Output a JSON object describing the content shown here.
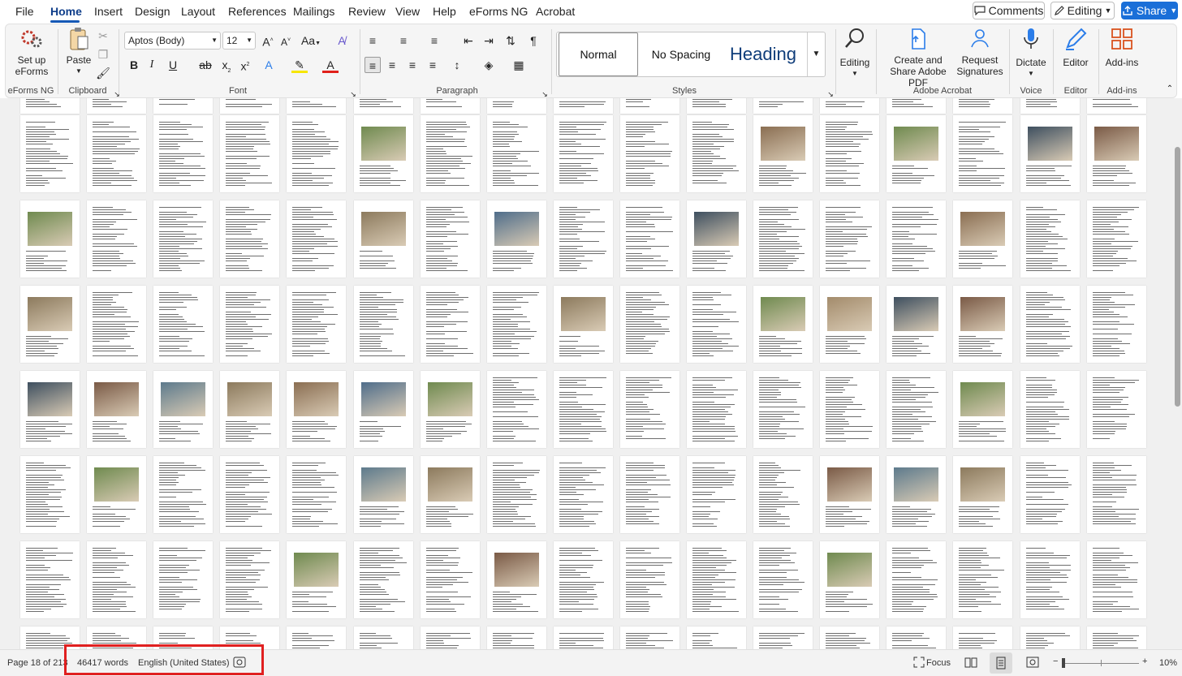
{
  "menu": {
    "tabs": [
      "File",
      "Home",
      "Insert",
      "Design",
      "Layout",
      "References",
      "Mailings",
      "Review",
      "View",
      "Help",
      "eForms NG",
      "Acrobat"
    ],
    "active_tab": "Home",
    "comments_label": "Comments",
    "editing_label": "Editing",
    "share_label": "Share"
  },
  "ribbon": {
    "eforms": {
      "button_label": "Set up eForms",
      "group_label": "eForms NG"
    },
    "clipboard": {
      "paste_label": "Paste",
      "group_label": "Clipboard"
    },
    "font": {
      "font_name": "Aptos (Body)",
      "font_size": "12",
      "group_label": "Font"
    },
    "paragraph": {
      "group_label": "Paragraph"
    },
    "styles": {
      "items": [
        "Normal",
        "No Spacing",
        "Heading"
      ],
      "selected": "Normal",
      "group_label": "Styles"
    },
    "editing": {
      "label": "Editing"
    },
    "acrobat": {
      "create_label": "Create and Share Adobe PDF",
      "request_label": "Request Signatures",
      "group_label": "Adobe Acrobat"
    },
    "voice": {
      "dictate_label": "Dictate",
      "group_label": "Voice"
    },
    "editor": {
      "label": "Editor",
      "group_label": "Editor"
    },
    "addins": {
      "label": "Add-ins",
      "group_label": "Add-ins"
    }
  },
  "document": {
    "view": "multi-page thumbnails",
    "image_pages": [
      [
        0,
        5
      ],
      [
        0,
        11
      ],
      [
        0,
        13
      ],
      [
        0,
        15
      ],
      [
        0,
        16
      ],
      [
        1,
        0
      ],
      [
        1,
        5
      ],
      [
        1,
        7
      ],
      [
        1,
        10
      ],
      [
        1,
        14
      ],
      [
        2,
        0
      ],
      [
        2,
        8
      ],
      [
        2,
        11
      ],
      [
        2,
        12
      ],
      [
        2,
        13
      ],
      [
        2,
        14
      ],
      [
        3,
        0
      ],
      [
        3,
        1
      ],
      [
        3,
        2
      ],
      [
        3,
        3
      ],
      [
        3,
        4
      ],
      [
        3,
        5
      ],
      [
        3,
        6
      ],
      [
        3,
        14
      ],
      [
        4,
        1
      ],
      [
        4,
        5
      ],
      [
        4,
        6
      ],
      [
        4,
        12
      ],
      [
        4,
        13
      ],
      [
        4,
        14
      ],
      [
        5,
        4
      ],
      [
        5,
        7
      ],
      [
        5,
        12
      ]
    ]
  },
  "status": {
    "page": "Page 18 of 213",
    "words": "46417 words",
    "language": "English (United States)",
    "focus_label": "Focus",
    "zoom": "10%"
  },
  "colors": {
    "accent": "#1a6fd8",
    "highlight_box": "#e02020"
  }
}
